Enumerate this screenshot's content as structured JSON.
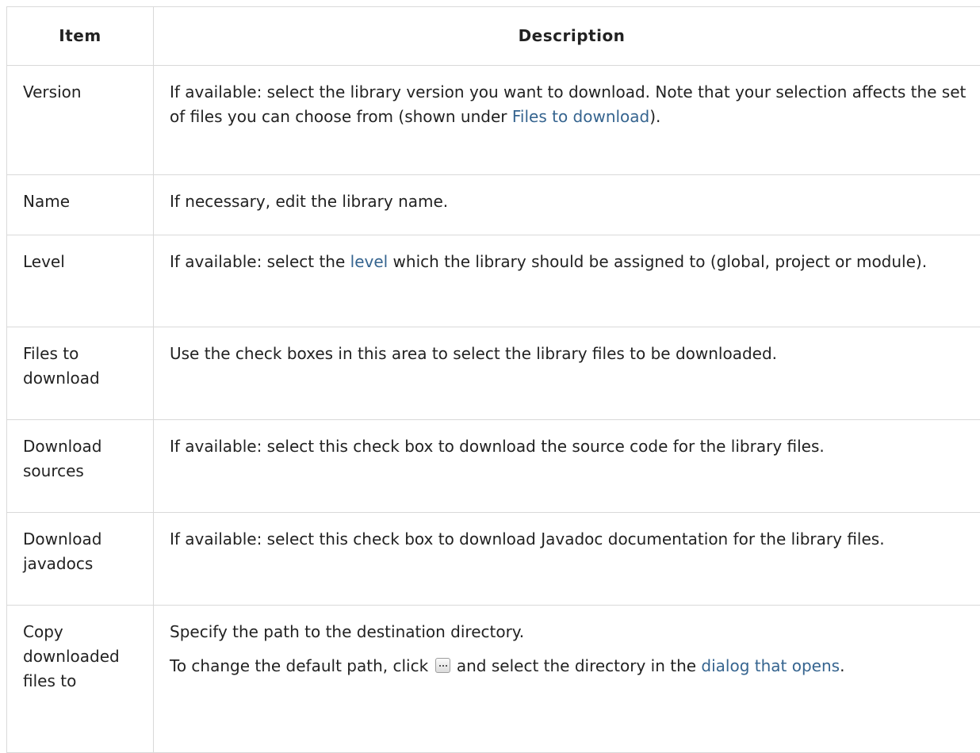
{
  "table": {
    "headers": {
      "item": "Item",
      "description": "Description"
    },
    "rows": {
      "version": {
        "item": "Version",
        "desc_1": "If available: select the library version you want to download. Note that your selection affects the set of files you can choose from (shown under ",
        "link_1": "Files to download",
        "desc_2": ")."
      },
      "name": {
        "item": "Name",
        "desc_1": "If necessary, edit the library name."
      },
      "level": {
        "item": "Level",
        "desc_1": "If available: select the ",
        "link_1": "level",
        "desc_2": " which the library should be assigned to (global, project or module)."
      },
      "files": {
        "item": "Files to download",
        "desc_1": "Use the check boxes in this area to select the library files to be downloaded."
      },
      "sources": {
        "item": "Download sources",
        "desc_1": "If available: select this check box to download the source code for the library files."
      },
      "javadocs": {
        "item": "Download javadocs",
        "desc_1": "If available: select this check box to download Javadoc documentation for the library files."
      },
      "copy": {
        "item": "Copy downloaded files to",
        "para_1": "Specify the path to the destination directory.",
        "para_2_a": "To change the default path, click ",
        "para_2_icon": "browse-ellipsis-icon",
        "para_2_b": " and select the directory in the ",
        "link_1": "dialog that opens",
        "para_2_c": "."
      }
    }
  },
  "colors": {
    "link": "#35648f",
    "border": "#d9d9d9",
    "text": "#222222"
  }
}
